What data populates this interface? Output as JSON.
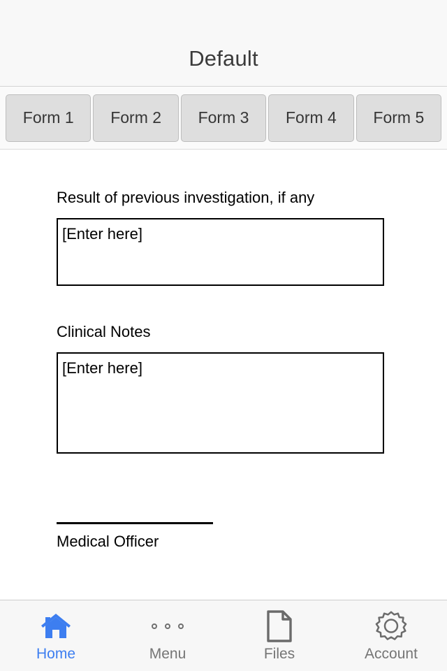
{
  "header": {
    "title": "Default"
  },
  "tabs": [
    {
      "label": "Form 1",
      "active": false
    },
    {
      "label": "Form 2",
      "active": false
    },
    {
      "label": "Form 3",
      "active": false
    },
    {
      "label": "Form 4",
      "active": false
    },
    {
      "label": "Form 5",
      "active": false
    }
  ],
  "form": {
    "fields": [
      {
        "label": "Result of previous investigation, if any",
        "placeholder": "[Enter here]",
        "value": ""
      },
      {
        "label": "Clinical Notes",
        "placeholder": "[Enter here]",
        "value": ""
      }
    ],
    "signature": {
      "label": "Medical Officer"
    }
  },
  "bottom_nav": {
    "items": [
      {
        "label": "Home",
        "icon": "home-icon",
        "active": true
      },
      {
        "label": "Menu",
        "icon": "menu-dots-icon",
        "active": false
      },
      {
        "label": "Files",
        "icon": "document-icon",
        "active": false
      },
      {
        "label": "Account",
        "icon": "gear-icon",
        "active": false
      }
    ]
  },
  "colors": {
    "accent": "#3d7ef0",
    "inactive_nav": "#757575",
    "tab_background": "#dedede",
    "tab_border": "#bdbdbd",
    "header_background": "#f8f8f8",
    "nav_background": "#f7f7f7",
    "title_text": "#3b3b3b",
    "field_text": "#000000"
  }
}
